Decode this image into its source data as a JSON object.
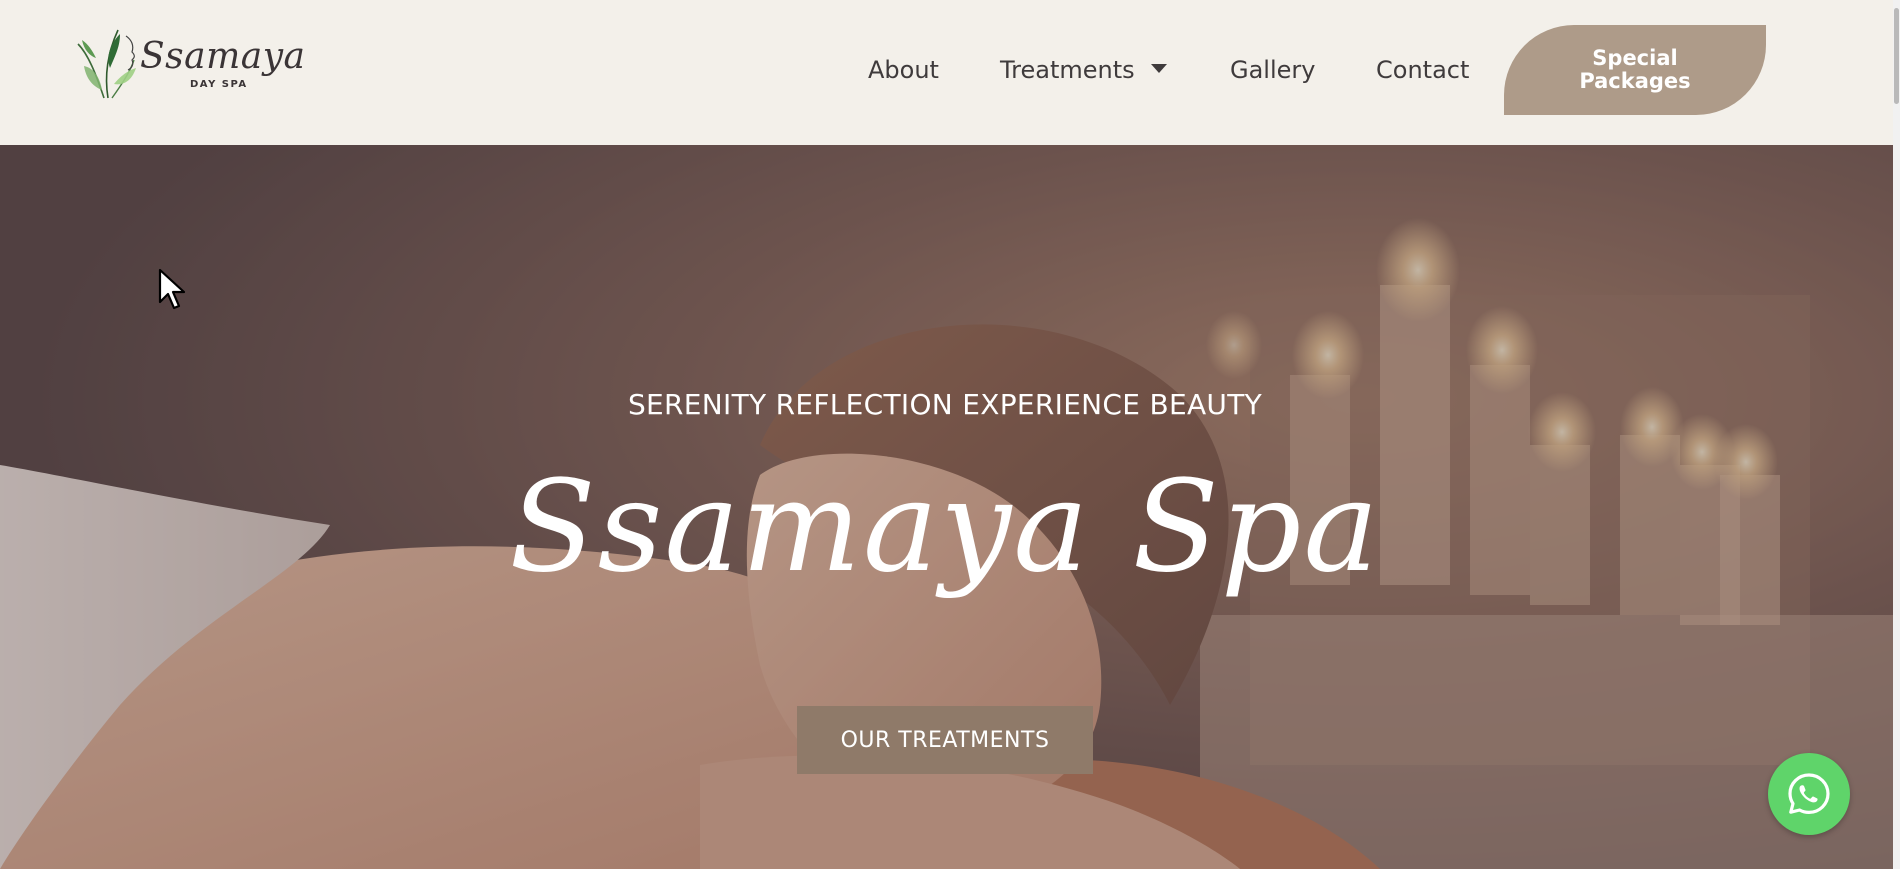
{
  "brand": {
    "name": "Ssamaya",
    "subtitle": "DAY SPA"
  },
  "nav": {
    "items": [
      {
        "label": "About"
      },
      {
        "label": "Treatments",
        "has_dropdown": true
      },
      {
        "label": "Gallery"
      },
      {
        "label": "Contact"
      }
    ],
    "cta_line1": "Special",
    "cta_line2": "Packages"
  },
  "hero": {
    "tagline": "SERENITY REFLECTION EXPERIENCE BEAUTY",
    "title": "Ssamaya Spa",
    "button_label": "OUR TREATMENTS"
  },
  "icons": {
    "whatsapp": "whatsapp-icon",
    "dropdown": "chevron-down-icon",
    "logo_leaf": "leaf-icon"
  },
  "colors": {
    "header_bg": "#f3f0ea",
    "accent": "#ae9b89",
    "hero_button": "#8f7a69",
    "whatsapp": "#5fd46a",
    "nav_text": "#3f3b3c"
  }
}
